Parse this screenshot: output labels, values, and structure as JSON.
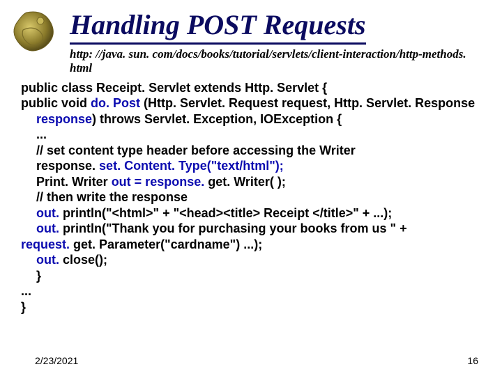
{
  "title": "Handling POST Requests",
  "url": "http: //java. sun. com/docs/books/tutorial/servlets/client-interaction/http-methods. html",
  "code": {
    "line1": "public class Receipt. Servlet extends Http. Servlet {",
    "line2a": "public void ",
    "line2b": "do. Post",
    "line2c": " (Http. Servlet. Request request, Http. Servlet. Response ",
    "line2d": "response",
    "line2e": ") throws Servlet. Exception, IOException {",
    "line3": "...",
    "line4": "// set content type header before accessing the Writer",
    "line5a": "response. ",
    "line5b": "set. Content. Type(\"text/html\");",
    "line6a": "Print. Writer ",
    "line6b": "out = response.",
    "line6c": " get. Writer( );",
    "line7": "// then write the response",
    "line8a": "out.",
    "line8b": " println(\"<html>\" + \"<head><title> Receipt </title>\" + ...);",
    "line9a": "out.",
    "line9b": " println(\"Thank you for purchasing your books from us \" + ",
    "line9c": "request.",
    "line9d": " get. Parameter(\"cardname\")  ...);",
    "line10a": "out.",
    "line10b": " close();",
    "line11": "}",
    "line12": "...",
    "line13": "}"
  },
  "footer": {
    "date": "2/23/2021",
    "page": "16"
  }
}
